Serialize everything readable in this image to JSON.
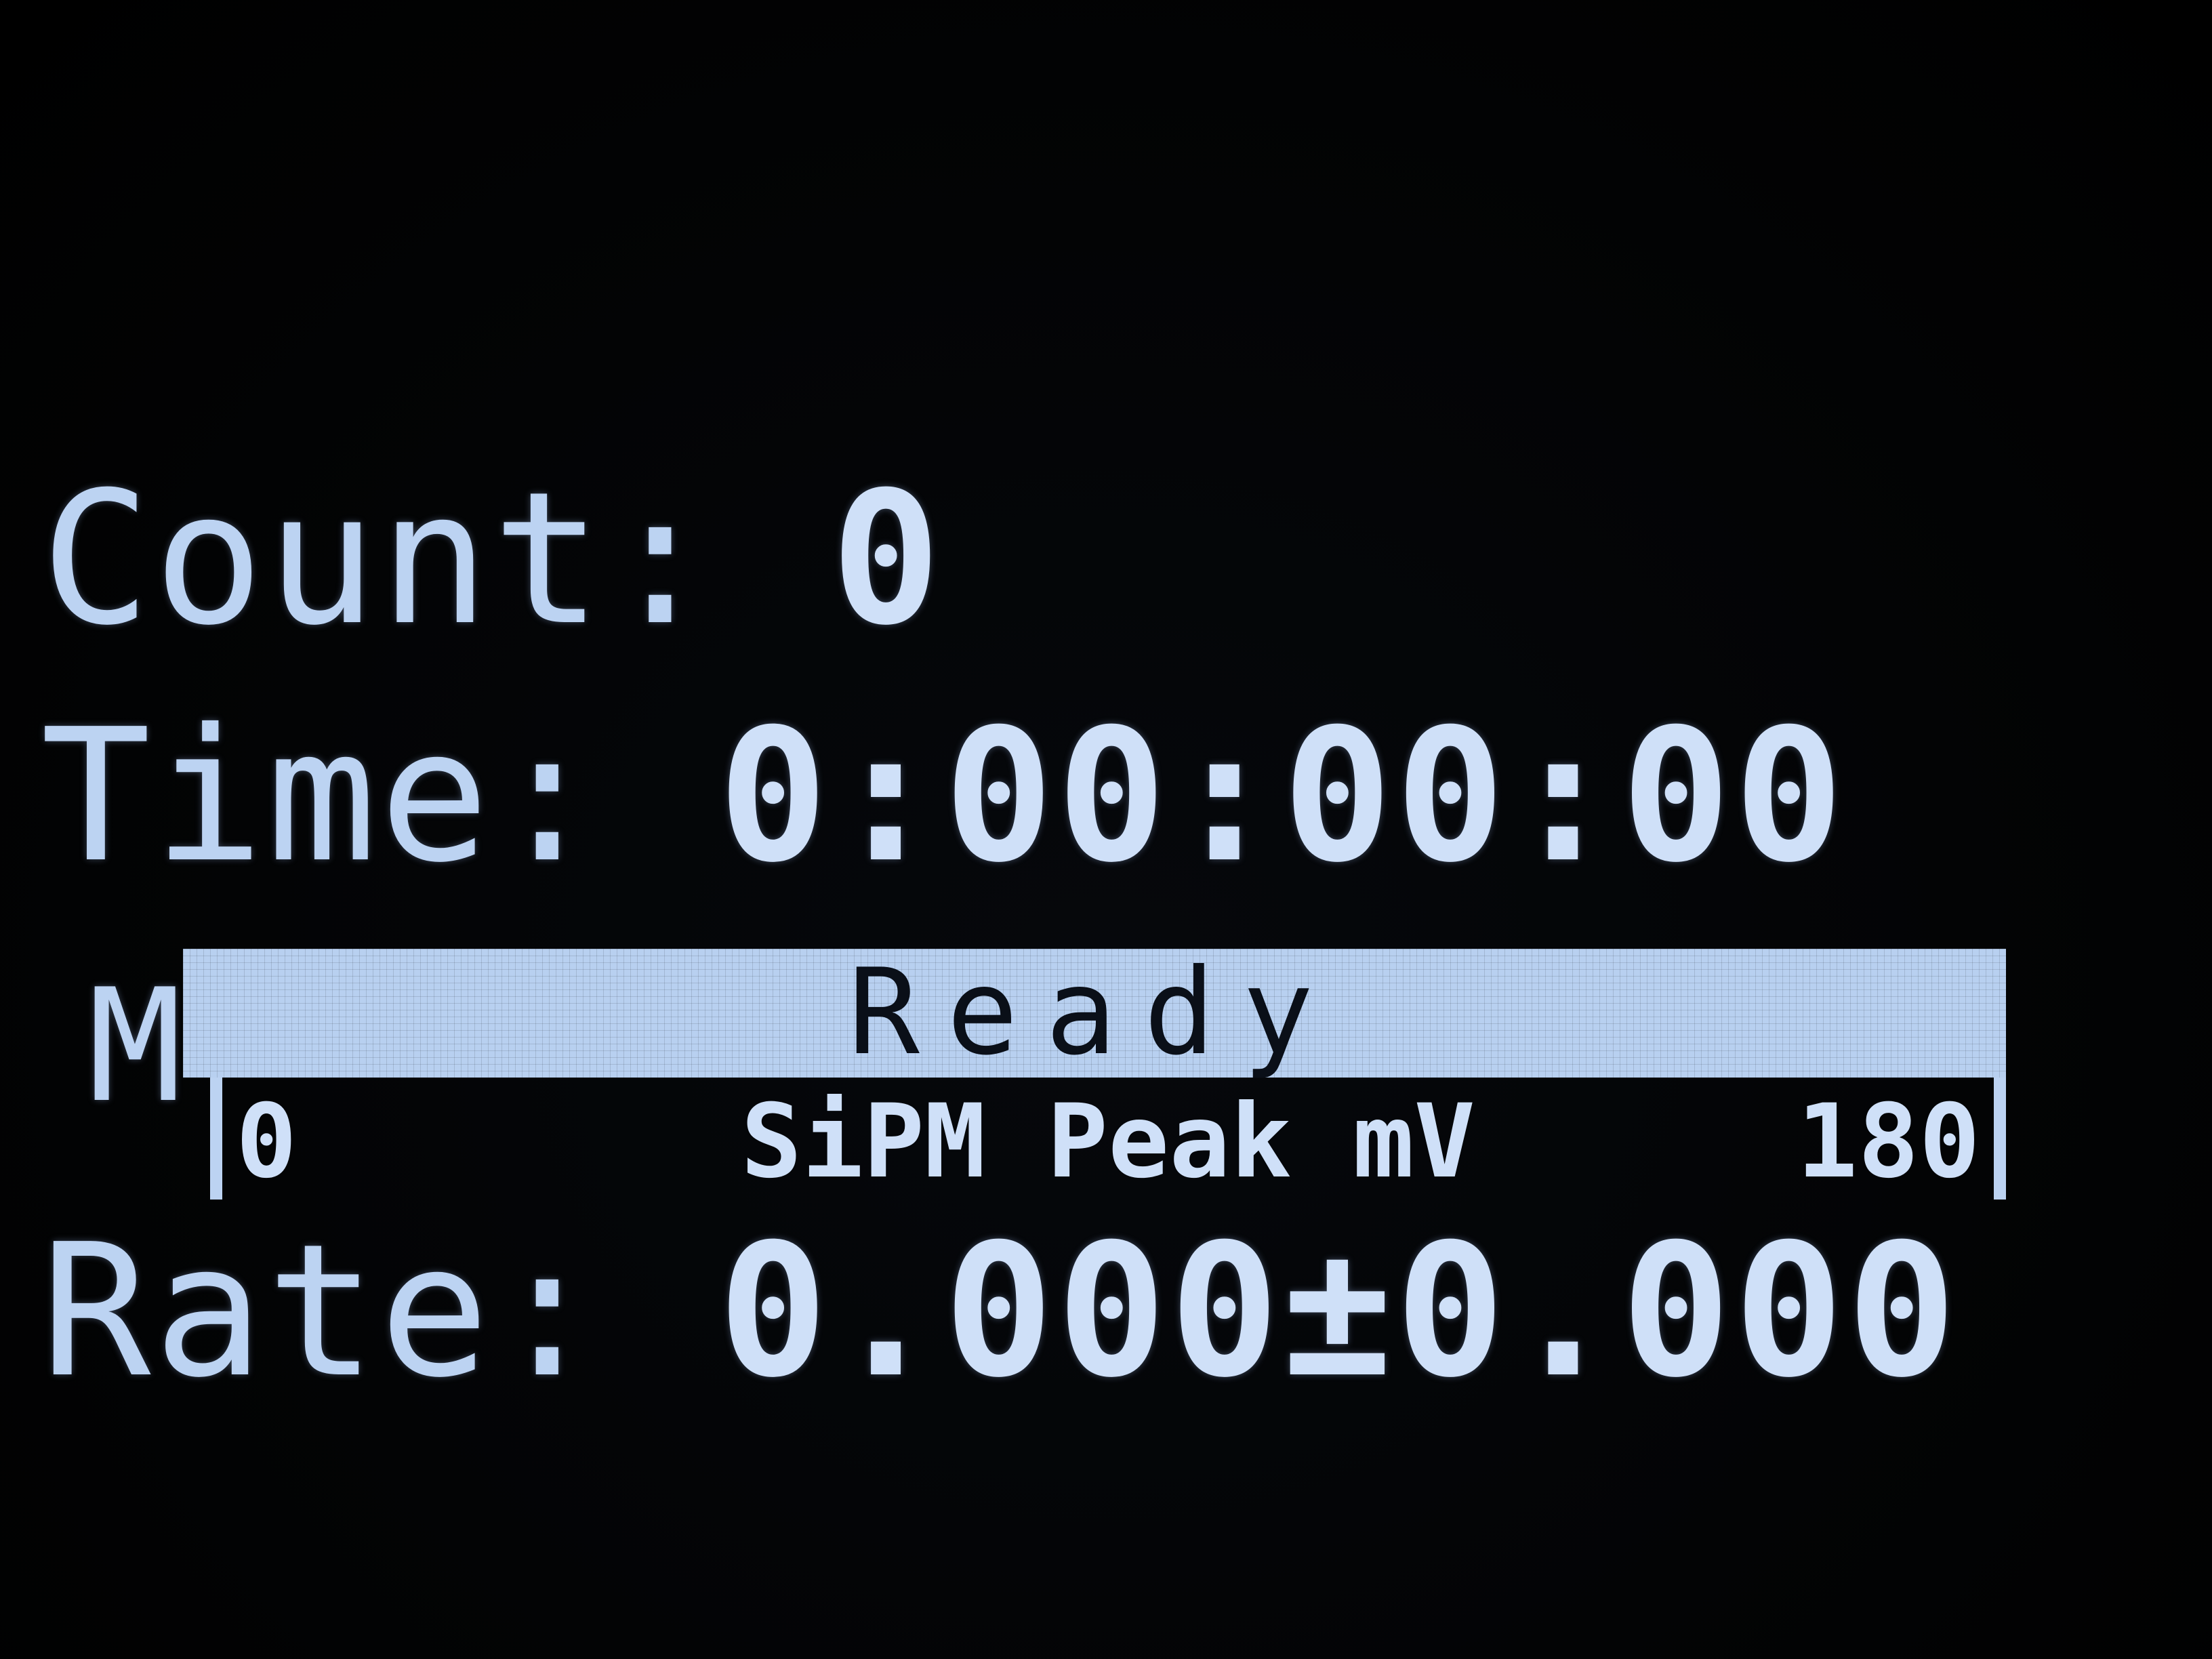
{
  "count": {
    "label": "Count:",
    "value": "0"
  },
  "time": {
    "label": "Time:",
    "value": "0:00:00:00"
  },
  "status": {
    "text": "Ready"
  },
  "mode": {
    "char": "M"
  },
  "scale": {
    "min": "0",
    "label": "SiPM Peak mV",
    "max": "180",
    "level": 0.0
  },
  "rate": {
    "label": "Rate:",
    "value": "0.000±0.000"
  }
}
